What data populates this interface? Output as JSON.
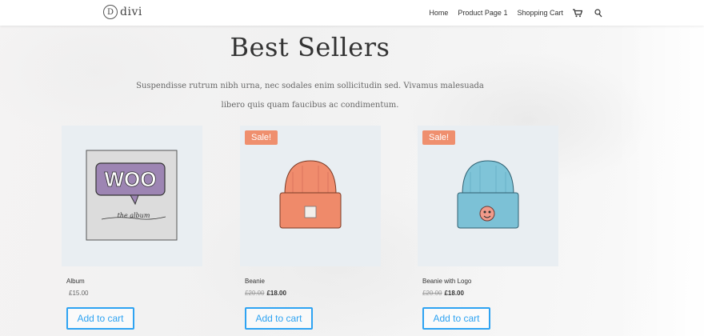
{
  "brand": {
    "name": "divi",
    "mark": "D"
  },
  "nav": {
    "items": [
      "Home",
      "Product Page 1",
      "Shopping Cart"
    ]
  },
  "section": {
    "title": "Best Sellers",
    "description_line1": "Suspendisse rutrum nibh urna, nec sodales enim sollicitudin sed. Vivamus malesuada",
    "description_line2": "libero quis quam faucibus ac condimentum."
  },
  "products": [
    {
      "name": "Album",
      "price": "£15.00",
      "old_price": "",
      "sale_badge": "",
      "button": "Add to cart",
      "icon": "woo-album-image"
    },
    {
      "name": "Beanie",
      "price": "£18.00",
      "old_price": "£20.00",
      "sale_badge": "Sale!",
      "button": "Add to cart",
      "icon": "orange-beanie-image"
    },
    {
      "name": "Beanie with Logo",
      "price": "£18.00",
      "old_price": "£20.00",
      "sale_badge": "Sale!",
      "button": "Add to cart",
      "icon": "blue-beanie-logo-image"
    }
  ],
  "colors": {
    "accent": "#2ea3f2",
    "sale_badge": "#ef8f6e",
    "card_bg": "#e9eef2"
  }
}
